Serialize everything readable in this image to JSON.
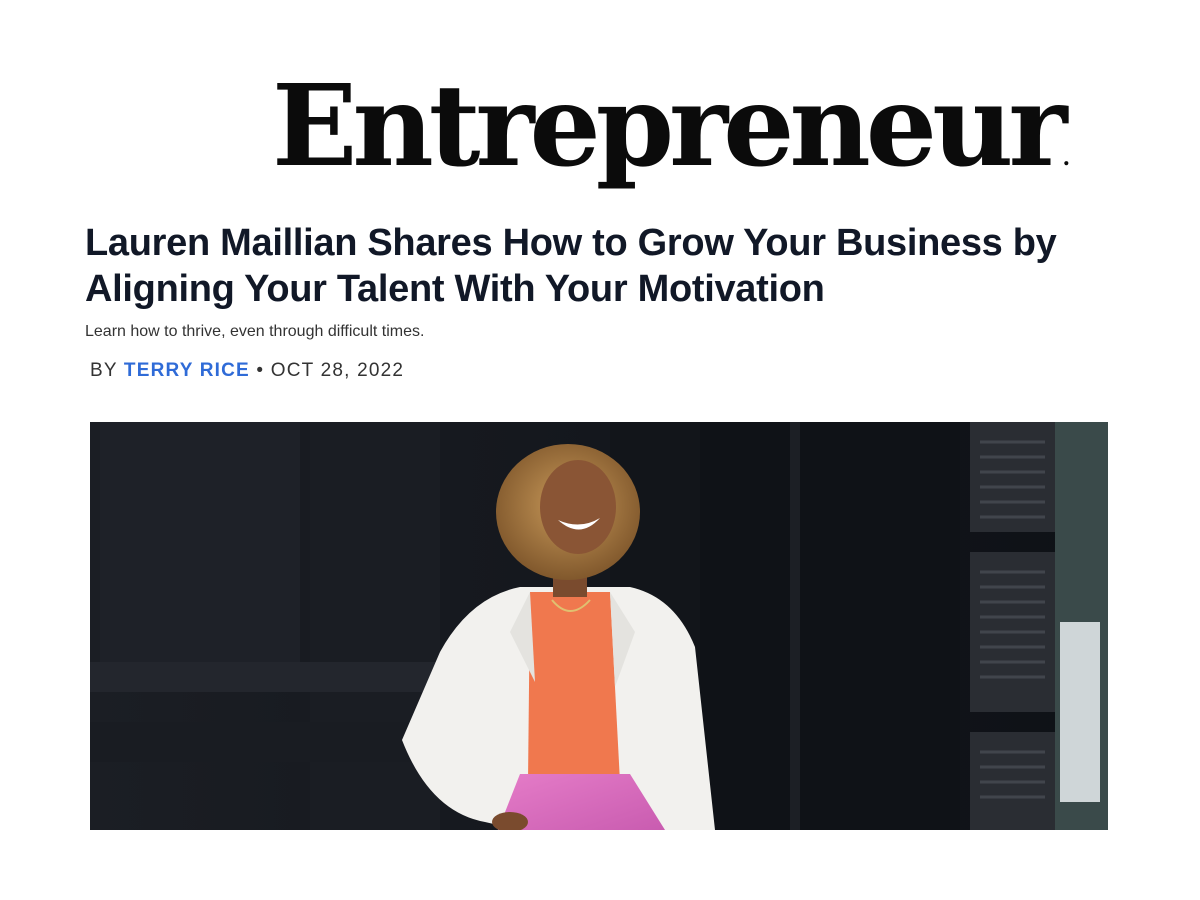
{
  "site": {
    "logo_text": "Entrepreneur",
    "logo_mark": "."
  },
  "article": {
    "headline": "Lauren Maillian Shares How to Grow Your Business by Aligning Your Talent With Your Motivation",
    "subtitle": "Learn how to thrive, even through difficult times.",
    "byline": {
      "prefix": "BY",
      "author": "TERRY RICE",
      "separator": "•",
      "date": "OCT 28, 2022"
    }
  },
  "hero_image": {
    "alt": "Smiling woman in white blazer, orange top and pink skirt standing in front of a dark building"
  },
  "colors": {
    "author_link": "#2f6bd7",
    "headline": "#111827",
    "background": "#ffffff"
  }
}
